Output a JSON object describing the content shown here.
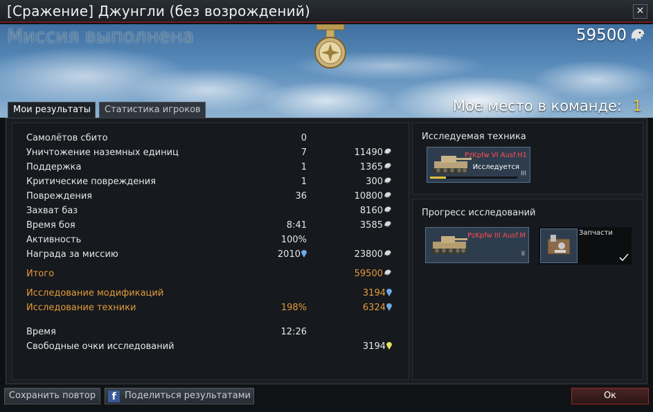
{
  "window": {
    "title": "[Сражение] Джунгли (без возрождений)",
    "close_label": "✕"
  },
  "banner": {
    "mission_result": "Миссия выполнена",
    "total_reward": "59500",
    "place_label": "Мое место в команде:",
    "place_value": "1"
  },
  "tabs": [
    {
      "label": "Мои результаты",
      "active": true
    },
    {
      "label": "Статистика игроков",
      "active": false
    }
  ],
  "stats": {
    "rows": [
      {
        "label": "Самолётов сбито",
        "count": "0",
        "reward": "",
        "reward_icon": ""
      },
      {
        "label": "Уничтожение наземных единиц",
        "count": "7",
        "reward": "11490",
        "reward_icon": "silver-lion-icon"
      },
      {
        "label": "Поддержка",
        "count": "1",
        "reward": "1365",
        "reward_icon": "silver-lion-icon"
      },
      {
        "label": "Критические повреждения",
        "count": "1",
        "reward": "300",
        "reward_icon": "silver-lion-icon"
      },
      {
        "label": "Повреждения",
        "count": "36",
        "reward": "10800",
        "reward_icon": "silver-lion-icon"
      },
      {
        "label": "Захват баз",
        "count": "",
        "reward": "8160",
        "reward_icon": "silver-lion-icon"
      },
      {
        "label": "Время боя",
        "count": "8:41",
        "reward": "3585",
        "reward_icon": "silver-lion-icon"
      },
      {
        "label": "Активность",
        "count": "100%",
        "reward": "",
        "reward_icon": ""
      },
      {
        "label": "Награда за миссию",
        "count": "2010",
        "count_icon": "research-point-icon",
        "reward": "23800",
        "reward_icon": "silver-lion-icon"
      }
    ],
    "total": {
      "label": "Итого",
      "reward": "59500",
      "reward_icon": "silver-lion-icon"
    },
    "research_mods": {
      "label": "Исследование модификаций",
      "reward": "3194",
      "reward_icon": "research-point-icon"
    },
    "research_vehicle": {
      "label": "Исследование техники",
      "percent": "198%",
      "reward": "6324",
      "reward_icon": "research-point-icon"
    },
    "time": {
      "label": "Время",
      "value": "12:26"
    },
    "free_rp": {
      "label": "Свободные очки исследований",
      "reward": "3194",
      "reward_icon": "free-research-point-icon"
    }
  },
  "researched": {
    "title": "Исследуемая техника",
    "vehicle": {
      "name": "PzKpfw VI Ausf.H1",
      "status": "Исследуется",
      "rank": "III",
      "progress": 0.18
    }
  },
  "progress": {
    "title": "Прогресс исследований",
    "vehicle": {
      "name": "PzKpfw III Ausf.M",
      "rank": "II"
    },
    "parts": {
      "label": "Запчасти",
      "completed": true
    }
  },
  "footer": {
    "save_replay": "Сохранить повтор",
    "share_icon": "f",
    "share": "Поделиться результатами",
    "ok": "Ок"
  },
  "colors": {
    "accent_orange": "#e39b3b",
    "place_yellow": "#f2c94c",
    "vehicle_name_red": "#ff4d4d",
    "research_blue": "#6fa8e8",
    "free_rp_yellow": "#e8e35a"
  }
}
